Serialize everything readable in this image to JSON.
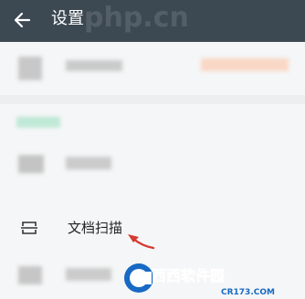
{
  "header": {
    "title": "设置",
    "back_icon": "arrow-left-icon"
  },
  "watermark": {
    "top": "php.cn",
    "side": "php"
  },
  "rows": [
    {
      "name": "blurred-account-row"
    },
    {
      "name": "blurred-section-header"
    },
    {
      "name": "blurred-setting-row"
    }
  ],
  "scan": {
    "label": "文档扫描",
    "icon": "scan-icon"
  },
  "logo": {
    "brand": "西西软件园",
    "domain": "CR173.COM"
  },
  "colors": {
    "appbar": "#3c4852",
    "accent": "#d63a2f",
    "logo_blue": "#1769c4"
  }
}
